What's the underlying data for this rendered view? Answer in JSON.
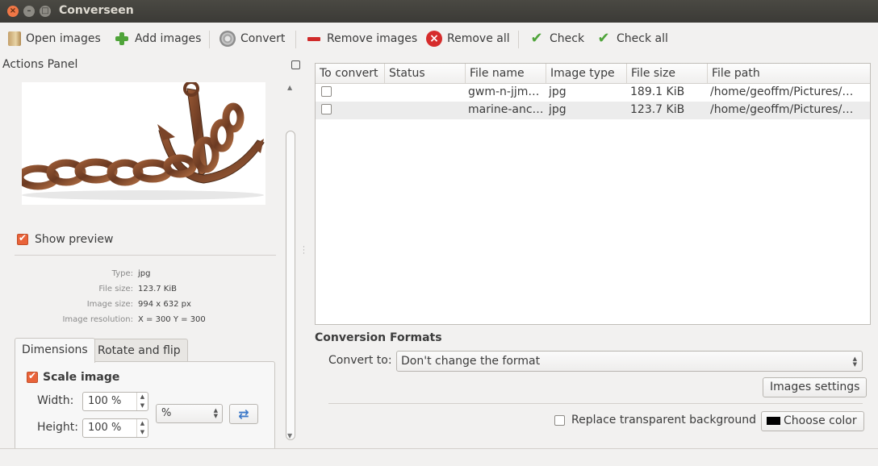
{
  "window": {
    "title": "Converseen"
  },
  "toolbar": {
    "open_images": "Open images",
    "add_images": "Add images",
    "convert": "Convert",
    "remove_images": "Remove images",
    "remove_all": "Remove all",
    "check": "Check",
    "check_all": "Check all"
  },
  "actions_panel": {
    "title": "Actions Panel",
    "show_preview": {
      "label": "Show preview",
      "checked": true
    },
    "info": [
      {
        "label": "Type:",
        "value": "jpg"
      },
      {
        "label": "File size:",
        "value": "123.7 KiB"
      },
      {
        "label": "Image size:",
        "value": "994 x 632 px"
      },
      {
        "label": "Image resolution:",
        "value": "X = 300 Y = 300"
      }
    ],
    "tabs": [
      "Dimensions",
      "Rotate and flip"
    ],
    "active_tab": "Dimensions",
    "scale_image": {
      "label": "Scale image",
      "checked": true
    },
    "width_label": "Width:",
    "width_value": "100 %",
    "height_label": "Height:",
    "height_value": "100 %",
    "unit": "%"
  },
  "table": {
    "headers": [
      "To convert",
      "Status",
      "File name",
      "Image type",
      "File size",
      "File path"
    ],
    "rows": [
      {
        "checked": false,
        "status": "",
        "file_name": "gwm-n-jjm…",
        "image_type": "jpg",
        "file_size": "189.1 KiB",
        "file_path": "/home/geoffm/Pictures/…"
      },
      {
        "checked": false,
        "status": "",
        "file_name": "marine-anc…",
        "image_type": "jpg",
        "file_size": "123.7 KiB",
        "file_path": "/home/geoffm/Pictures/…"
      }
    ]
  },
  "conversion": {
    "title": "Conversion Formats",
    "convert_to_label": "Convert to:",
    "format_value": "Don't change the format",
    "images_settings": "Images settings",
    "replace_bg_label": "Replace transparent background",
    "replace_bg_checked": false,
    "choose_color": "Choose color",
    "color": "#000000"
  },
  "colors": {
    "accent": "#e9633a",
    "close": "#f07746"
  }
}
